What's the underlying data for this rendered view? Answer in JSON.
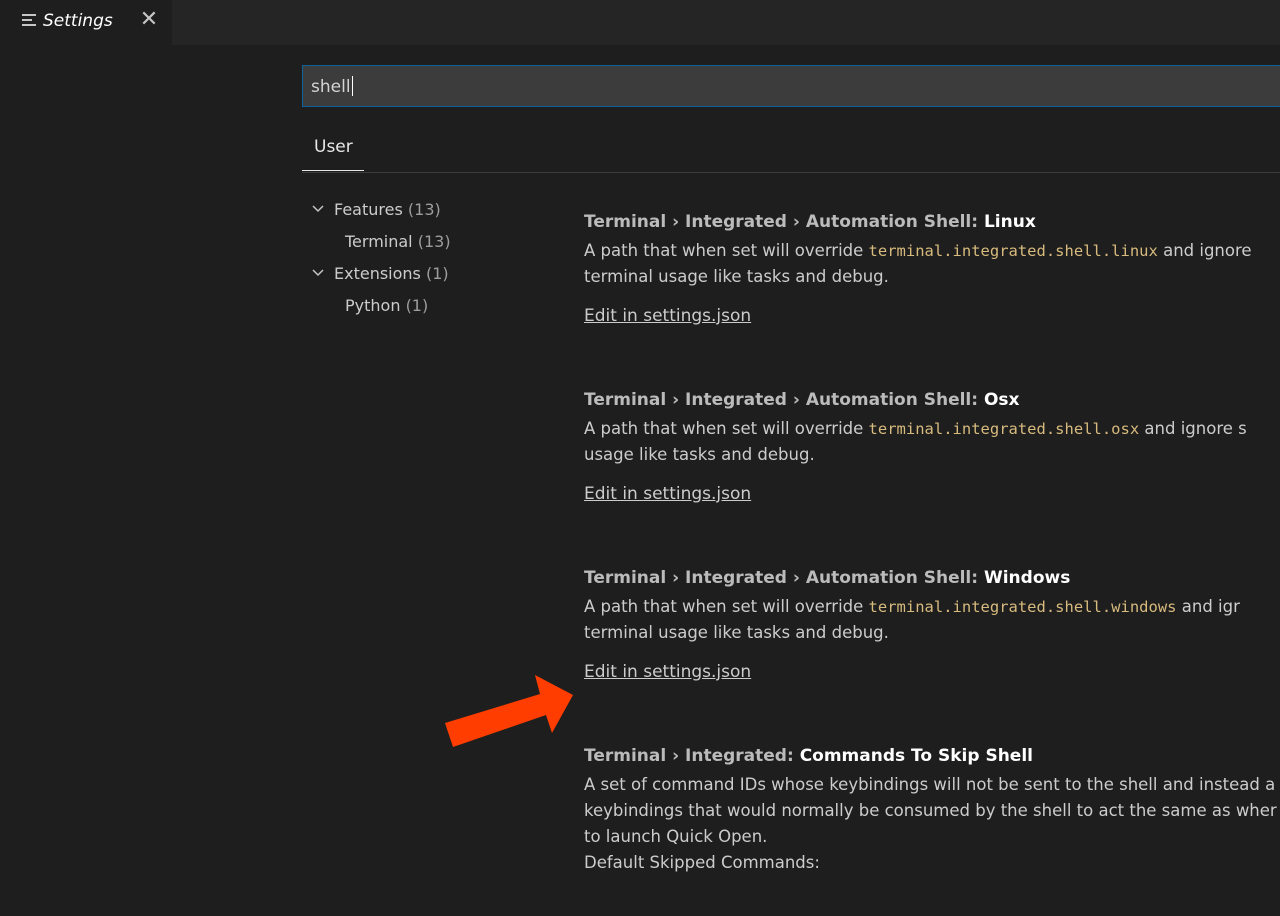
{
  "tab": {
    "title": "Settings",
    "icon": "settings-list-icon",
    "close": "✕"
  },
  "search": {
    "value": "shell"
  },
  "scope_tabs": [
    {
      "label": "User"
    }
  ],
  "toc": [
    {
      "label": "Features",
      "count": "(13)",
      "expanded": true
    },
    {
      "label": "Terminal",
      "count": "(13)"
    },
    {
      "label": "Extensions",
      "count": "(1)",
      "expanded": true
    },
    {
      "label": "Python",
      "count": "(1)"
    }
  ],
  "settings": [
    {
      "category": "Terminal › Integrated › Automation Shell: ",
      "name": "Linux",
      "desc_before": "A path that when set will override ",
      "code": "terminal.integrated.shell.linux",
      "desc_after": " and ignore",
      "desc_line2": "terminal usage like tasks and debug.",
      "link": "Edit in settings.json"
    },
    {
      "category": "Terminal › Integrated › Automation Shell: ",
      "name": "Osx",
      "desc_before": "A path that when set will override ",
      "code": "terminal.integrated.shell.osx",
      "desc_after": " and ignore s",
      "desc_line2": "usage like tasks and debug.",
      "link": "Edit in settings.json"
    },
    {
      "category": "Terminal › Integrated › Automation Shell: ",
      "name": "Windows",
      "desc_before": "A path that when set will override ",
      "code": "terminal.integrated.shell.windows",
      "desc_after": " and igr",
      "desc_line2": "terminal usage like tasks and debug.",
      "link": "Edit in settings.json"
    },
    {
      "category": "Terminal › Integrated: ",
      "name": "Commands To Skip Shell",
      "lines": [
        "A set of command IDs whose keybindings will not be sent to the shell and instead a",
        "keybindings that would normally be consumed by the shell to act the same as wher",
        "to launch Quick Open.",
        "Default Skipped Commands:"
      ]
    }
  ],
  "colors": {
    "accent_arrow": "#ff3d00",
    "code": "#d7ba7d",
    "focus_border": "#0e639c"
  }
}
